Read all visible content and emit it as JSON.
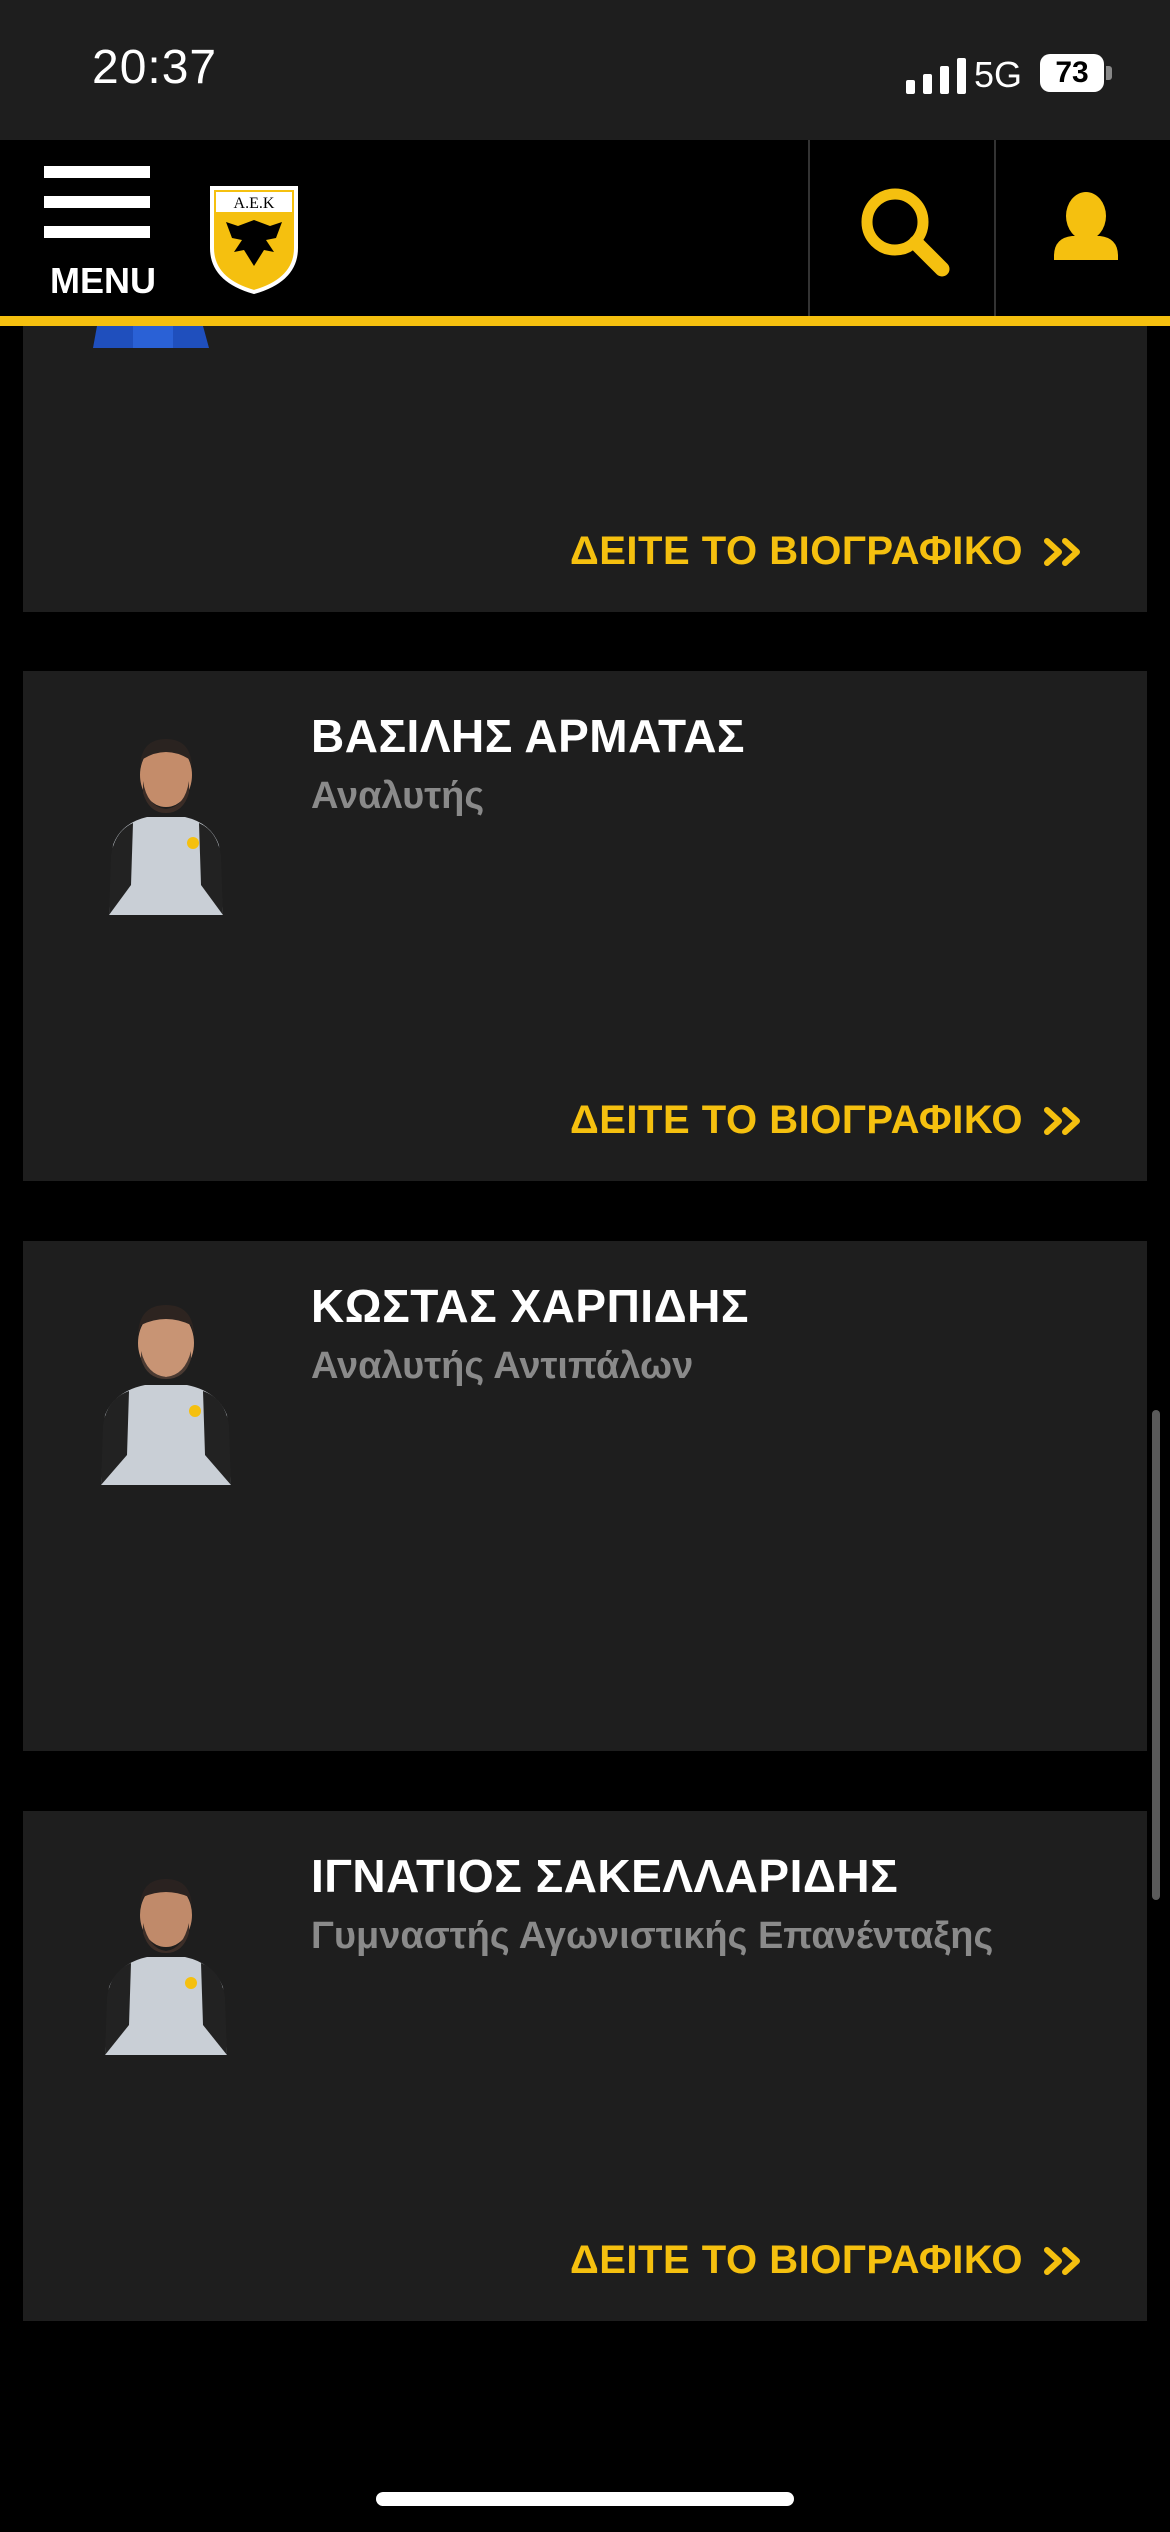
{
  "status_bar": {
    "time": "20:37",
    "network": "5G",
    "battery": "73"
  },
  "header": {
    "menu_label": "MENU",
    "logo_text": "Α.Ε.Κ",
    "search_icon": "search-icon",
    "user_icon": "user-icon",
    "accent_color": "#f5c00f"
  },
  "cards": [
    {
      "name": "",
      "role": "",
      "bio_label": "ΔΕΙΤΕ ΤΟ ΒΙΟΓΡΑΦΙΚΟ"
    },
    {
      "name": "ΒΑΣΙΛΗΣ ΑΡΜΑΤΑΣ",
      "role": "Αναλυτής",
      "bio_label": "ΔΕΙΤΕ ΤΟ ΒΙΟΓΡΑΦΙΚΟ"
    },
    {
      "name": "ΚΩΣΤΑΣ ΧΑΡΠΙΔΗΣ",
      "role": "Αναλυτής Αντιπάλων"
    },
    {
      "name": "ΙΓΝΑΤΙΟΣ ΣΑΚΕΛΛΑΡΙΔΗΣ",
      "role": "Γυμναστής Αγωνιστικής Επανένταξης",
      "bio_label": "ΔΕΙΤΕ ΤΟ ΒΙΟΓΡΑΦΙΚΟ"
    }
  ]
}
